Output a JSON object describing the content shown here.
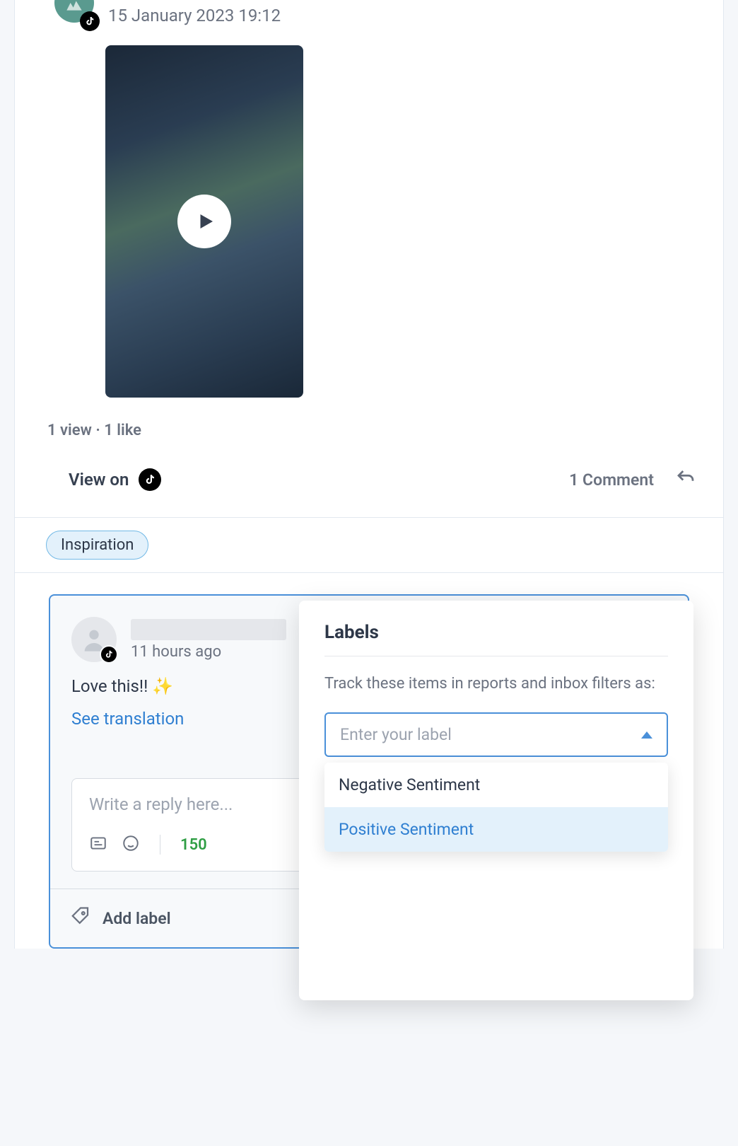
{
  "post": {
    "timestamp": "15 January 2023 19:12",
    "stats": "1 view · 1 like",
    "view_on_label": "View on",
    "comment_count": "1 Comment"
  },
  "tags": [
    "Inspiration"
  ],
  "comment": {
    "time_ago": "11 hours ago",
    "text": "Love this!! ✨",
    "see_translation": "See translation"
  },
  "reply": {
    "placeholder": "Write a reply here...",
    "char_count": "150"
  },
  "add_label": {
    "label": "Add label"
  },
  "labels_popover": {
    "title": "Labels",
    "description": "Track these items in reports and inbox filters as:",
    "placeholder": "Enter your label",
    "options": [
      "Negative Sentiment",
      "Positive Sentiment"
    ],
    "highlighted_index": 1
  }
}
